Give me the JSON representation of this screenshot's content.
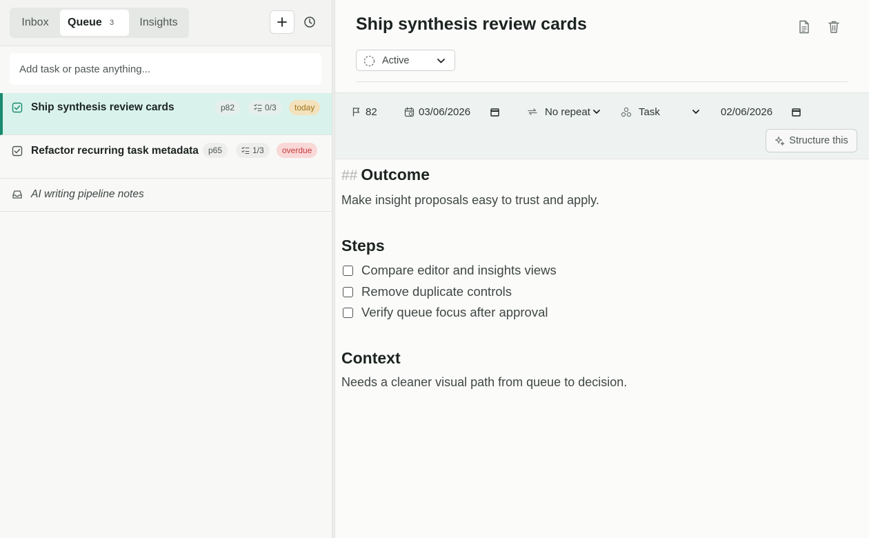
{
  "sidebar": {
    "tabs": [
      {
        "label": "Inbox"
      },
      {
        "label": "Queue",
        "count": "3"
      },
      {
        "label": "Insights"
      }
    ],
    "add_placeholder": "Add task or paste anything...",
    "items": [
      {
        "title": "Ship synthesis review cards",
        "priority": "p82",
        "subtasks": "0/3",
        "due_badge": "today",
        "selected": true
      },
      {
        "title": "Refactor recurring task metadata",
        "priority": "p65",
        "subtasks": "1/3",
        "due_badge": "overdue"
      },
      {
        "title": "AI writing pipeline notes"
      }
    ]
  },
  "detail": {
    "title": "Ship synthesis review cards",
    "status": "Active",
    "meta": {
      "priority": "82",
      "start_date": "03/06/2026",
      "repeat": "No repeat",
      "type": "Task",
      "due_date": "02/06/2026",
      "structure_label": "Structure this"
    },
    "content": {
      "heading_marker": "##",
      "outcome_heading": "Outcome",
      "outcome_text": "Make insight proposals easy to trust and apply.",
      "steps_heading": "Steps",
      "steps": [
        "Compare editor and insights views",
        "Remove duplicate controls",
        "Verify queue focus after approval"
      ],
      "context_heading": "Context",
      "context_text": "Needs a cleaner visual path from queue to decision."
    }
  },
  "colors": {
    "accent": "#1a8a6e",
    "selected_row": "#d9f3ec",
    "today_bg": "#f3e2bd",
    "overdue_bg": "#f9d8d8"
  },
  "icons": [
    "plus-icon",
    "clock-icon",
    "task-check-icon",
    "subtasks-icon",
    "inbox-icon",
    "document-icon",
    "trash-icon",
    "status-circle-icon",
    "chevron-down-icon",
    "flag-icon",
    "calendar-icon",
    "repeat-icon",
    "type-icon",
    "sparkle-icon"
  ]
}
